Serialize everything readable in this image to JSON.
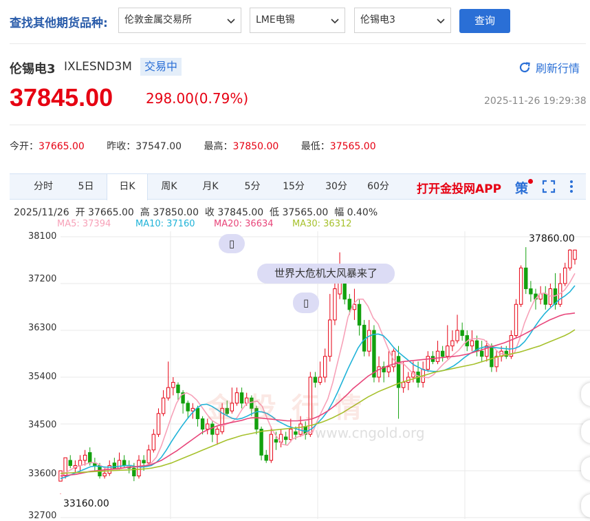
{
  "filter": {
    "label": "查找其他期货品种:",
    "exchange": "伦敦金属交易所",
    "commodity": "LME电锡",
    "contract": "伦锡电3",
    "query_label": "查询"
  },
  "quote": {
    "name": "伦锡电3",
    "code": "IXLESND3M",
    "status": "交易中",
    "refresh_label": "刷新行情",
    "price": "37845.00",
    "change": "298.00(0.79%)",
    "timestamp": "2025-11-26 19:29:38"
  },
  "stats": [
    {
      "label": "今开：",
      "value": "37665.00"
    },
    {
      "label": "昨收：",
      "value": "37547.00"
    },
    {
      "label": "最高：",
      "value": "37850.00"
    },
    {
      "label": "最低：",
      "value": "37565.00"
    }
  ],
  "tabs": [
    "分时",
    "5日",
    "日K",
    "周K",
    "月K",
    "5分",
    "15分",
    "30分",
    "60分"
  ],
  "active_tab": "日K",
  "app_link": "打开金投网APP",
  "ohlc_line": "2025/11/26  开 37665.00  高 37850.00  收 37845.00  低 37565.00  幅 0.40%",
  "ma": [
    {
      "label": "MA5: 37394",
      "color": "#f7a1b8"
    },
    {
      "label": "MA10: 37160",
      "color": "#1fb3d8"
    },
    {
      "label": "MA20: 36634",
      "color": "#e8457a"
    },
    {
      "label": "MA30: 36312",
      "color": "#a6c12c"
    }
  ],
  "chart_data": {
    "type": "candlestick",
    "y_ticks": [
      "38100",
      "37200",
      "36300",
      "35400",
      "34500",
      "33600",
      "32700"
    ],
    "ylim": [
      32700,
      38100
    ],
    "max_label": "37860.00",
    "min_label": "33160.00",
    "news_label": "世界大危机大风暴来了",
    "colors": {
      "up": "#e60012",
      "down": "#13a10e",
      "grid": "#e9e9e9"
    },
    "candles": [
      [
        33400,
        33600,
        33160,
        33150
      ],
      [
        33500,
        33850,
        33850,
        33450
      ],
      [
        33800,
        33700,
        33900,
        33650
      ],
      [
        33650,
        33700,
        33800,
        33550
      ],
      [
        33700,
        33800,
        33900,
        33600
      ],
      [
        33800,
        33900,
        34000,
        33700
      ],
      [
        33950,
        33750,
        34050,
        33700
      ],
      [
        33750,
        33700,
        33850,
        33600
      ],
      [
        33700,
        33500,
        33750,
        33450
      ],
      [
        33500,
        33550,
        33650,
        33450
      ],
      [
        33550,
        33700,
        33800,
        33500
      ],
      [
        33750,
        33650,
        33850,
        33600
      ],
      [
        33650,
        33800,
        33950,
        33600
      ],
      [
        33800,
        33700,
        33900,
        33650
      ],
      [
        33700,
        33650,
        33800,
        33550
      ],
      [
        33650,
        33500,
        33750,
        33400
      ],
      [
        33500,
        33800,
        33900,
        33450
      ],
      [
        33800,
        33750,
        33900,
        33600
      ],
      [
        33750,
        34000,
        34100,
        33700
      ],
      [
        34000,
        34300,
        34400,
        33950
      ],
      [
        34300,
        34700,
        34800,
        34250
      ],
      [
        34700,
        35000,
        35150,
        34650
      ],
      [
        35000,
        35200,
        35700,
        34950
      ],
      [
        35200,
        35300,
        35400,
        35050
      ],
      [
        35250,
        35100,
        35300,
        34950
      ],
      [
        35100,
        34900,
        35150,
        34700
      ],
      [
        34900,
        34750,
        34950,
        34600
      ],
      [
        34750,
        34800,
        34900,
        34600
      ],
      [
        34800,
        34600,
        34850,
        34450
      ],
      [
        34600,
        34400,
        34650,
        34300
      ],
      [
        34400,
        34500,
        34600,
        34300
      ],
      [
        34500,
        34300,
        34550,
        34150
      ],
      [
        34300,
        34400,
        34450,
        34100
      ],
      [
        34350,
        34800,
        34900,
        34300
      ],
      [
        34800,
        34700,
        34950,
        34650
      ],
      [
        34750,
        34900,
        35200,
        34700
      ],
      [
        34900,
        35100,
        35200,
        34850
      ],
      [
        35100,
        34900,
        35200,
        34800
      ],
      [
        34900,
        35000,
        35100,
        34850
      ],
      [
        35000,
        34800,
        35050,
        34650
      ],
      [
        34800,
        34400,
        34850,
        34300
      ],
      [
        34400,
        33900,
        34450,
        33800
      ],
      [
        33900,
        33800,
        34000,
        33750
      ],
      [
        33800,
        34300,
        34450,
        33750
      ],
      [
        34200,
        34150,
        34350,
        34000
      ],
      [
        34150,
        34300,
        34400,
        34050
      ],
      [
        34250,
        34200,
        34350,
        34100
      ],
      [
        34200,
        34400,
        34600,
        34150
      ],
      [
        34350,
        34300,
        34450,
        34200
      ],
      [
        34300,
        34500,
        34650,
        34250
      ],
      [
        34450,
        34300,
        34550,
        34200
      ],
      [
        34300,
        35400,
        35500,
        34250
      ],
      [
        35400,
        35300,
        35500,
        35200
      ],
      [
        35300,
        35400,
        35700,
        35250
      ],
      [
        35400,
        35800,
        35950,
        35300
      ],
      [
        35800,
        36500,
        37000,
        35700
      ],
      [
        36500,
        37100,
        37200,
        36400
      ],
      [
        37000,
        37500,
        37800,
        36900
      ],
      [
        37300,
        36900,
        37400,
        36800
      ],
      [
        36900,
        36700,
        37000,
        36600
      ],
      [
        36700,
        36800,
        37100,
        36500
      ],
      [
        36800,
        36400,
        36900,
        36200
      ],
      [
        36400,
        35900,
        36500,
        35800
      ],
      [
        35900,
        36300,
        36500,
        35800
      ],
      [
        36300,
        35400,
        36400,
        35300
      ],
      [
        35400,
        35600,
        35800,
        35300
      ],
      [
        35600,
        35500,
        35700,
        35300
      ],
      [
        35500,
        35600,
        35900,
        35400
      ],
      [
        35600,
        35900,
        35950,
        35500
      ],
      [
        35800,
        35200,
        36000,
        34600
      ],
      [
        35200,
        35300,
        35700,
        35100
      ],
      [
        35300,
        35400,
        35500,
        35150
      ],
      [
        35400,
        35500,
        35700,
        35300
      ],
      [
        35500,
        35300,
        35700,
        35200
      ],
      [
        35300,
        35550,
        35700,
        35200
      ],
      [
        35550,
        35800,
        35900,
        35500
      ],
      [
        35800,
        35700,
        35900,
        35650
      ],
      [
        35700,
        35900,
        36100,
        35650
      ],
      [
        35900,
        35800,
        36000,
        35700
      ],
      [
        35800,
        36000,
        36400,
        35750
      ],
      [
        36000,
        36100,
        36300,
        35900
      ],
      [
        36100,
        36300,
        36600,
        36050
      ],
      [
        36300,
        36200,
        36450,
        36100
      ],
      [
        36200,
        36000,
        36300,
        35900
      ],
      [
        36000,
        36100,
        36300,
        35900
      ],
      [
        36100,
        35900,
        36200,
        35800
      ],
      [
        35900,
        35800,
        36100,
        35700
      ],
      [
        35800,
        36000,
        36100,
        35700
      ],
      [
        36000,
        35600,
        36050,
        35500
      ],
      [
        35600,
        35800,
        35900,
        35500
      ],
      [
        35800,
        35900,
        36000,
        35700
      ],
      [
        35900,
        35800,
        36000,
        35750
      ],
      [
        35800,
        36200,
        36300,
        35750
      ],
      [
        36200,
        36800,
        36900,
        36150
      ],
      [
        36800,
        37500,
        37550,
        36750
      ],
      [
        37500,
        37100,
        37900,
        37000
      ],
      [
        37100,
        37000,
        37250,
        36850
      ],
      [
        37000,
        36900,
        37100,
        36700
      ],
      [
        36900,
        37000,
        37150,
        36800
      ],
      [
        37000,
        36800,
        37150,
        36700
      ],
      [
        36800,
        37100,
        37200,
        36750
      ],
      [
        37100,
        36800,
        37400,
        36700
      ],
      [
        36800,
        37200,
        37400,
        36750
      ],
      [
        37200,
        37500,
        37600,
        37150
      ],
      [
        37500,
        37845,
        37860,
        37450
      ],
      [
        37665,
        37845,
        37850,
        37565
      ]
    ],
    "ma5": [
      33500,
      33560,
      33620,
      33670,
      33700,
      33730,
      33760,
      33750,
      33700,
      33640,
      33620,
      33620,
      33640,
      33670,
      33700,
      33680,
      33690,
      33700,
      33750,
      33860,
      34080,
      34360,
      34640,
      34900,
      35060,
      35100,
      35050,
      34960,
      34830,
      34690,
      34570,
      34510,
      34460,
      34500,
      34540,
      34620,
      34780,
      34900,
      34920,
      34940,
      34840,
      34600,
      34380,
      34240,
      34110,
      34090,
      34210,
      34250,
      34280,
      34340,
      34340,
      34580,
      34780,
      34980,
      35300,
      35700,
      36100,
      36550,
      36800,
      36900,
      36900,
      36760,
      36540,
      36420,
      36180,
      35940,
      35740,
      35660,
      35660,
      35560,
      35460,
      35420,
      35400,
      35390,
      35450,
      35560,
      35660,
      35750,
      35840,
      35920,
      36040,
      36120,
      36140,
      36140,
      36120,
      36020,
      35960,
      35860,
      35840,
      35820,
      35860,
      36120,
      36440,
      36680,
      36880,
      37000,
      37020,
      36960,
      36960,
      37000,
      37080,
      37220,
      37394
    ],
    "ma10": [
      33450,
      33480,
      33520,
      33560,
      33600,
      33640,
      33680,
      33690,
      33680,
      33670,
      33670,
      33680,
      33690,
      33700,
      33700,
      33680,
      33670,
      33680,
      33700,
      33760,
      33860,
      34000,
      34160,
      34310,
      34450,
      34580,
      34700,
      34800,
      34870,
      34880,
      34840,
      34780,
      34710,
      34660,
      34610,
      34590,
      34610,
      34650,
      34700,
      34740,
      34730,
      34700,
      34640,
      34560,
      34510,
      34460,
      34430,
      34400,
      34370,
      34360,
      34420,
      34520,
      34620,
      34750,
      34920,
      35120,
      35340,
      35560,
      35760,
      35960,
      36100,
      36180,
      36220,
      36230,
      36200,
      36100,
      35980,
      35880,
      35800,
      35720,
      35640,
      35590,
      35540,
      35520,
      35510,
      35510,
      35530,
      35570,
      35620,
      35690,
      35770,
      35840,
      35900,
      35950,
      35980,
      35980,
      35970,
      35960,
      35950,
      35940,
      35950,
      35990,
      36080,
      36210,
      36360,
      36500,
      36620,
      36720,
      36810,
      36900,
      36960,
      37040,
      37160
    ],
    "ma20": [
      33500,
      33510,
      33520,
      33530,
      33550,
      33570,
      33590,
      33600,
      33610,
      33620,
      33630,
      33640,
      33650,
      33660,
      33670,
      33680,
      33690,
      33700,
      33720,
      33760,
      33800,
      33860,
      33920,
      33980,
      34050,
      34120,
      34190,
      34260,
      34330,
      34380,
      34420,
      34460,
      34490,
      34510,
      34530,
      34550,
      34570,
      34600,
      34620,
      34620,
      34610,
      34600,
      34590,
      34580,
      34570,
      34560,
      34560,
      34560,
      34570,
      34580,
      34600,
      34640,
      34690,
      34750,
      34820,
      34900,
      34990,
      35080,
      35180,
      35260,
      35340,
      35420,
      35480,
      35540,
      35580,
      35620,
      35650,
      35680,
      35700,
      35710,
      35720,
      35730,
      35740,
      35750,
      35760,
      35770,
      35780,
      35790,
      35800,
      35810,
      35830,
      35850,
      35880,
      35910,
      35940,
      35970,
      36000,
      36030,
      36060,
      36100,
      36140,
      36180,
      36230,
      36280,
      36340,
      36400,
      36450,
      36500,
      36540,
      36580,
      36610,
      36620,
      36634
    ],
    "ma30": [
      33550,
      33555,
      33560,
      33565,
      33570,
      33575,
      33580,
      33585,
      33590,
      33595,
      33600,
      33605,
      33610,
      33615,
      33620,
      33625,
      33630,
      33640,
      33650,
      33670,
      33690,
      33720,
      33750,
      33790,
      33830,
      33870,
      33910,
      33950,
      33990,
      34030,
      34070,
      34110,
      34150,
      34190,
      34220,
      34250,
      34280,
      34300,
      34320,
      34340,
      34360,
      34370,
      34380,
      34390,
      34400,
      34410,
      34420,
      34430,
      34440,
      34460,
      34480,
      34510,
      34540,
      34580,
      34620,
      34670,
      34720,
      34780,
      34840,
      34900,
      34960,
      35020,
      35070,
      35120,
      35160,
      35200,
      35240,
      35280,
      35310,
      35340,
      35370,
      35400,
      35430,
      35460,
      35490,
      35510,
      35530,
      35550,
      35570,
      35590,
      35610,
      35630,
      35650,
      35680,
      35710,
      35740,
      35770,
      35800,
      35820,
      35840,
      35860,
      35880,
      35910,
      35940,
      35970,
      36000,
      36040,
      36080,
      36120,
      36160,
      36200,
      36250,
      36312
    ]
  }
}
